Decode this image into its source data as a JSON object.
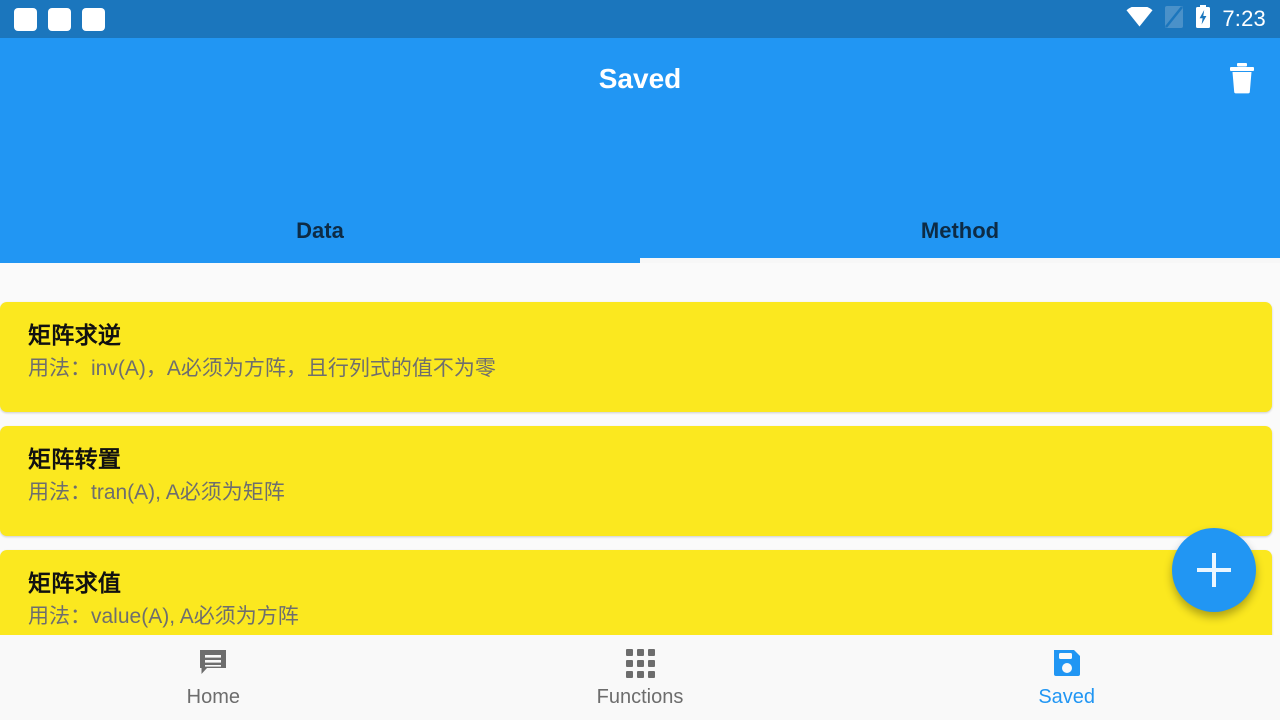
{
  "status_bar": {
    "notification_icons": [
      "placeholder-icon",
      "placeholder-icon",
      "placeholder-icon"
    ],
    "wifi_icon": "wifi-icon",
    "sim_icon": "no-sim-icon",
    "battery_icon": "battery-charging-icon",
    "clock": "7:23",
    "background_color": "#1b76bd"
  },
  "app_bar": {
    "title": "Saved",
    "delete_icon": "trash-icon",
    "background_color": "#2196f3",
    "tabs": [
      {
        "label": "Data",
        "active": false
      },
      {
        "label": "Method",
        "active": true
      }
    ]
  },
  "list": {
    "card_color": "#fbe81f",
    "items": [
      {
        "title": "矩阵求逆",
        "subtitle": "用法：inv(A)，A必须为方阵，且行列式的值不为零"
      },
      {
        "title": "矩阵转置",
        "subtitle": "用法：tran(A), A必须为矩阵"
      },
      {
        "title": "矩阵求值",
        "subtitle": "用法：value(A), A必须为方阵"
      }
    ]
  },
  "fab": {
    "icon": "plus-icon",
    "color": "#2196f3"
  },
  "bottom_nav": {
    "active_color": "#2196f3",
    "inactive_color": "#6d6d6d",
    "items": [
      {
        "label": "Home",
        "icon": "message-icon",
        "active": false
      },
      {
        "label": "Functions",
        "icon": "grid-icon",
        "active": false
      },
      {
        "label": "Saved",
        "icon": "save-icon",
        "active": true
      }
    ]
  }
}
